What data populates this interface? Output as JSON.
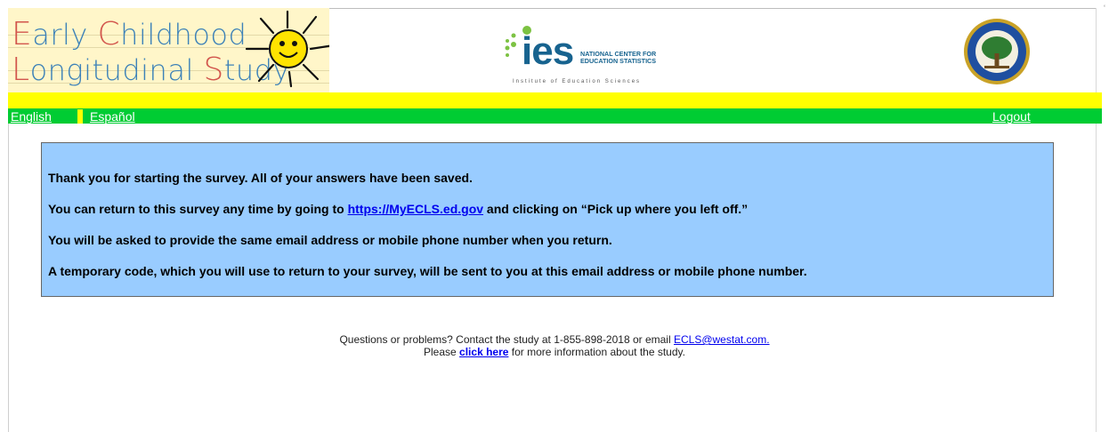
{
  "header": {
    "logo": {
      "line1": [
        {
          "text": "E",
          "cap": true
        },
        {
          "text": "arly ",
          "cap": false
        },
        {
          "text": "C",
          "cap": true
        },
        {
          "text": "hildhood",
          "cap": false
        }
      ],
      "line2": [
        {
          "text": "L",
          "cap": true
        },
        {
          "text": "ongitudinal ",
          "cap": false
        },
        {
          "text": "S",
          "cap": true
        },
        {
          "text": "tudy",
          "cap": false
        }
      ]
    },
    "ies_logo": {
      "word": "ies",
      "nces_line1": "NATIONAL CENTER FOR",
      "nces_line2": "EDUCATION STATISTICS",
      "institute": "Institute of Education Sciences"
    },
    "seal_icon": "department-of-education-seal"
  },
  "nav": {
    "english": "English",
    "spanish": "Español",
    "logout": "Logout"
  },
  "message": {
    "line1": "Thank you for starting the survey. All of your answers have been saved.",
    "line2_before": "You can return to this survey any time by going to ",
    "line2_link": "https://MyECLS.ed.gov",
    "line2_after": " and clicking on “Pick up where you left off.”",
    "line3": "You will be asked to provide the same email address or mobile phone number when you return.",
    "line4": "A temporary code, which you will use to return to your survey, will be sent to you at this email address or mobile phone number."
  },
  "footer": {
    "line1_text": "Questions or problems? Contact the study at 1-855-898-2018 or email ",
    "line1_email": "ECLS@westat.com.",
    "line2_before": "Please ",
    "line2_link": "click here",
    "line2_after": " for more information about the study."
  },
  "colors": {
    "nav_green": "#00cc33",
    "nav_yellow": "#ffff00",
    "message_bg": "#99ccff",
    "link": "#0000ee"
  }
}
